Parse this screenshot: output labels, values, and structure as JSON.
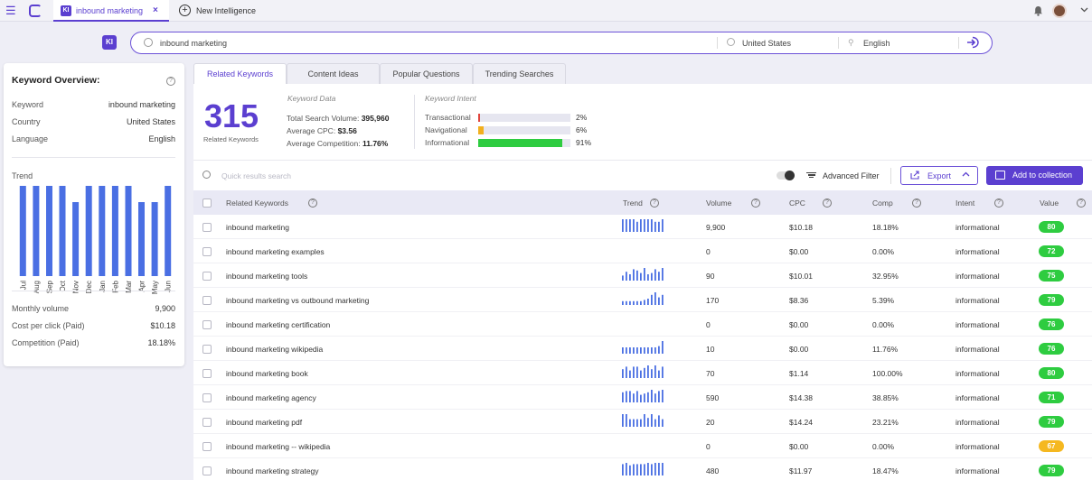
{
  "topbar": {
    "tab_badge": "KI",
    "tab_title": "inbound marketing",
    "tab_close": "×",
    "new_tab_label": "New Intelligence"
  },
  "search": {
    "badge": "KI",
    "query": "inbound marketing",
    "country": "United States",
    "language": "English"
  },
  "overview": {
    "title": "Keyword Overview:",
    "rows": [
      {
        "label": "Keyword",
        "value": "inbound marketing"
      },
      {
        "label": "Country",
        "value": "United States"
      },
      {
        "label": "Language",
        "value": "English"
      }
    ],
    "trend_label": "Trend",
    "trend": {
      "months": [
        "Jul",
        "Aug",
        "Sep",
        "Oct",
        "Nov",
        "Dec",
        "Jan",
        "Feb",
        "Mar",
        "Apr",
        "May",
        "Jun"
      ],
      "values": [
        100,
        100,
        100,
        100,
        82,
        100,
        100,
        100,
        100,
        82,
        82,
        100
      ],
      "ylim": [
        0,
        100
      ],
      "color": "#4a6fe3"
    },
    "stats": [
      {
        "label": "Monthly volume",
        "value": "9,900"
      },
      {
        "label": "Cost per click (Paid)",
        "value": "$10.18"
      },
      {
        "label": "Competition (Paid)",
        "value": "18.18%"
      }
    ]
  },
  "tabs": [
    "Related Keywords",
    "Content Ideas",
    "Popular Questions",
    "Trending Searches"
  ],
  "summary": {
    "count": "315",
    "count_label": "Related Keywords",
    "data_title": "Keyword Data",
    "data_rows": [
      {
        "label": "Total Search Volume:",
        "value": "395,960"
      },
      {
        "label": "Average CPC:",
        "value": "$3.56"
      },
      {
        "label": "Average Competition:",
        "value": "11.76%"
      }
    ],
    "intent_title": "Keyword Intent",
    "intents": [
      {
        "label": "Transactional",
        "pct": 2,
        "pct_text": "2%",
        "color": "#e0443c"
      },
      {
        "label": "Navigational",
        "pct": 6,
        "pct_text": "6%",
        "color": "#f2b01e"
      },
      {
        "label": "Informational",
        "pct": 91,
        "pct_text": "91%",
        "color": "#2ecc40"
      }
    ]
  },
  "toolbar": {
    "search_placeholder": "Quick results search",
    "advanced_filter": "Advanced Filter",
    "export": "Export",
    "add_to_collection": "Add to collection"
  },
  "table": {
    "headers": {
      "keyword": "Related Keywords",
      "trend": "Trend",
      "volume": "Volume",
      "cpc": "CPC",
      "comp": "Comp",
      "intent": "Intent",
      "value": "Value"
    },
    "rows": [
      {
        "keyword": "inbound marketing",
        "trend": [
          10,
          10,
          10,
          10,
          8,
          10,
          10,
          10,
          10,
          8,
          8,
          10
        ],
        "volume": "9,900",
        "cpc": "$10.18",
        "comp": "18.18%",
        "intent": "informational",
        "value": "80",
        "value_color": "#2ecc40"
      },
      {
        "keyword": "inbound marketing examples",
        "trend": [],
        "volume": "0",
        "cpc": "$0.00",
        "comp": "0.00%",
        "intent": "informational",
        "value": "72",
        "value_color": "#2ecc40"
      },
      {
        "keyword": "inbound marketing tools",
        "trend": [
          4,
          7,
          5,
          9,
          8,
          6,
          10,
          5,
          6,
          9,
          7,
          10
        ],
        "volume": "90",
        "cpc": "$10.01",
        "comp": "32.95%",
        "intent": "informational",
        "value": "75",
        "value_color": "#2ecc40"
      },
      {
        "keyword": "inbound marketing vs outbound marketing",
        "trend": [
          3,
          3,
          3,
          3,
          3,
          3,
          4,
          5,
          8,
          10,
          6,
          8
        ],
        "volume": "170",
        "cpc": "$8.36",
        "comp": "5.39%",
        "intent": "informational",
        "value": "79",
        "value_color": "#2ecc40"
      },
      {
        "keyword": "inbound marketing certification",
        "trend": [],
        "volume": "0",
        "cpc": "$0.00",
        "comp": "0.00%",
        "intent": "informational",
        "value": "76",
        "value_color": "#2ecc40"
      },
      {
        "keyword": "inbound marketing wikipedia",
        "trend": [
          5,
          5,
          5,
          5,
          5,
          5,
          5,
          5,
          5,
          5,
          6,
          10
        ],
        "volume": "10",
        "cpc": "$0.00",
        "comp": "11.76%",
        "intent": "informational",
        "value": "76",
        "value_color": "#2ecc40"
      },
      {
        "keyword": "inbound marketing book",
        "trend": [
          7,
          9,
          6,
          9,
          9,
          6,
          8,
          10,
          7,
          10,
          6,
          9
        ],
        "volume": "70",
        "cpc": "$1.14",
        "comp": "100.00%",
        "intent": "informational",
        "value": "80",
        "value_color": "#2ecc40"
      },
      {
        "keyword": "inbound marketing agency",
        "trend": [
          8,
          9,
          9,
          7,
          9,
          6,
          7,
          8,
          10,
          7,
          9,
          10
        ],
        "volume": "590",
        "cpc": "$14.38",
        "comp": "38.85%",
        "intent": "informational",
        "value": "71",
        "value_color": "#2ecc40"
      },
      {
        "keyword": "inbound marketing pdf",
        "trend": [
          10,
          10,
          6,
          6,
          6,
          6,
          10,
          7,
          10,
          6,
          9,
          6
        ],
        "volume": "20",
        "cpc": "$14.24",
        "comp": "23.21%",
        "intent": "informational",
        "value": "79",
        "value_color": "#2ecc40"
      },
      {
        "keyword": "inbound marketing -- wikipedia",
        "trend": [],
        "volume": "0",
        "cpc": "$0.00",
        "comp": "0.00%",
        "intent": "informational",
        "value": "67",
        "value_color": "#f5b820"
      },
      {
        "keyword": "inbound marketing strategy",
        "trend": [
          9,
          10,
          8,
          9,
          9,
          9,
          9,
          10,
          9,
          10,
          10,
          10
        ],
        "volume": "480",
        "cpc": "$11.97",
        "comp": "18.47%",
        "intent": "informational",
        "value": "79",
        "value_color": "#2ecc40"
      }
    ]
  },
  "colors": {
    "accent": "#5b3fd0",
    "chart_blue": "#4a6fe3",
    "green": "#2ecc40",
    "yellow": "#f5b820",
    "red": "#e0443c"
  },
  "icons": [
    "menu-icon",
    "app-logo-icon",
    "plus-circle-icon",
    "bell-icon",
    "avatar",
    "chevron-down-icon",
    "crosshair-icon",
    "location-icon",
    "language-icon",
    "arrow-right-circle-icon",
    "help-icon",
    "search-icon",
    "toggle-icon",
    "filter-icon",
    "export-icon",
    "folder-plus-icon"
  ]
}
